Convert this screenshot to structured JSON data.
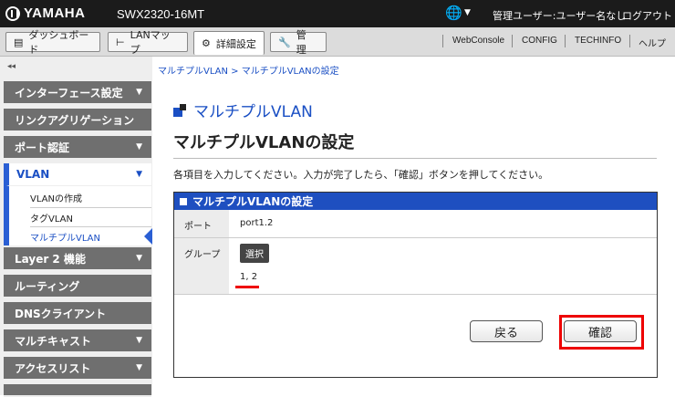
{
  "header": {
    "logo_text": "YAMAHA",
    "model": "SWX2320-16MT",
    "user_info": "管理ユーザー:ユーザー名なし",
    "logout": "ログアウト"
  },
  "tabs": [
    {
      "label": "ダッシュボード",
      "icon": "dashboard-icon"
    },
    {
      "label": "LANマップ",
      "icon": "lanmap-icon"
    },
    {
      "label": "詳細設定",
      "icon": "gear-icon"
    },
    {
      "label": "管　理",
      "icon": "wrench-icon"
    }
  ],
  "top_links": [
    "WebConsole",
    "CONFIG",
    "TECHINFO",
    "ヘルプ"
  ],
  "sidebar": {
    "collapse": "◂◂",
    "items": [
      {
        "label": "インターフェース設定",
        "caret": "▼"
      },
      {
        "label": "リンクアグリゲーション",
        "caret": ""
      },
      {
        "label": "ポート認証",
        "caret": "▼"
      },
      {
        "label": "VLAN",
        "caret": "▼"
      },
      {
        "label": "Layer 2 機能",
        "caret": "▼"
      },
      {
        "label": "ルーティング",
        "caret": ""
      },
      {
        "label": "DNSクライアント",
        "caret": ""
      },
      {
        "label": "マルチキャスト",
        "caret": "▼"
      },
      {
        "label": "アクセスリスト",
        "caret": "▼"
      }
    ],
    "vlan_sub": [
      "VLANの作成",
      "タグVLAN",
      "マルチプルVLAN"
    ]
  },
  "breadcrumb": "マルチプルVLAN > マルチプルVLANの設定",
  "page": {
    "heading": "マルチプルVLAN",
    "title": "マルチプルVLANの設定",
    "instruction": "各項目を入力してください。入力が完了したら、「確認」ボタンを押してください。"
  },
  "panel": {
    "title": "マルチプルVLANの設定",
    "port_label": "ポート",
    "port_value": "port1.2",
    "group_label": "グループ",
    "select_label": "選択",
    "group_value": "1, 2"
  },
  "buttons": {
    "back": "戻る",
    "confirm": "確認"
  },
  "colors": {
    "accent": "#1e4fc0",
    "highlight": "#e00000",
    "topbar": "#1b1b1b"
  }
}
